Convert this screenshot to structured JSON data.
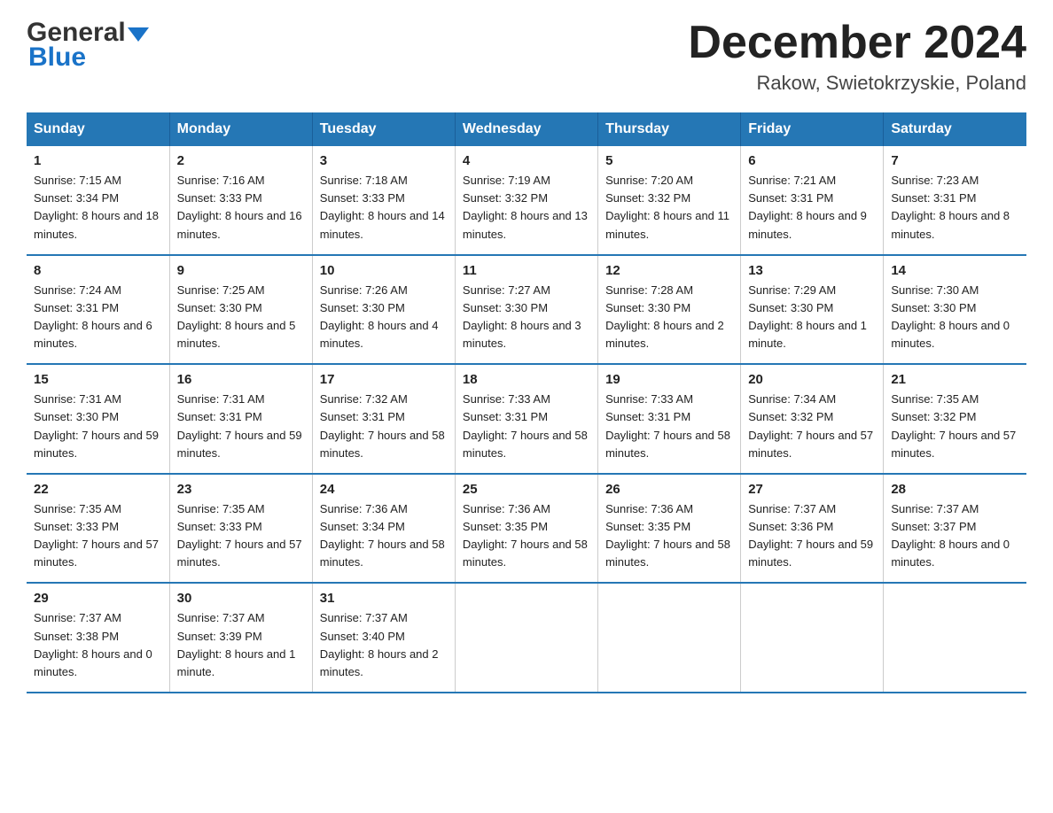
{
  "logo": {
    "line1": "General",
    "arrow": "▼",
    "line2": "Blue"
  },
  "title": {
    "month_year": "December 2024",
    "location": "Rakow, Swietokrzyskie, Poland"
  },
  "columns": [
    "Sunday",
    "Monday",
    "Tuesday",
    "Wednesday",
    "Thursday",
    "Friday",
    "Saturday"
  ],
  "weeks": [
    [
      {
        "day": "1",
        "sunrise": "7:15 AM",
        "sunset": "3:34 PM",
        "daylight": "8 hours and 18 minutes."
      },
      {
        "day": "2",
        "sunrise": "7:16 AM",
        "sunset": "3:33 PM",
        "daylight": "8 hours and 16 minutes."
      },
      {
        "day": "3",
        "sunrise": "7:18 AM",
        "sunset": "3:33 PM",
        "daylight": "8 hours and 14 minutes."
      },
      {
        "day": "4",
        "sunrise": "7:19 AM",
        "sunset": "3:32 PM",
        "daylight": "8 hours and 13 minutes."
      },
      {
        "day": "5",
        "sunrise": "7:20 AM",
        "sunset": "3:32 PM",
        "daylight": "8 hours and 11 minutes."
      },
      {
        "day": "6",
        "sunrise": "7:21 AM",
        "sunset": "3:31 PM",
        "daylight": "8 hours and 9 minutes."
      },
      {
        "day": "7",
        "sunrise": "7:23 AM",
        "sunset": "3:31 PM",
        "daylight": "8 hours and 8 minutes."
      }
    ],
    [
      {
        "day": "8",
        "sunrise": "7:24 AM",
        "sunset": "3:31 PM",
        "daylight": "8 hours and 6 minutes."
      },
      {
        "day": "9",
        "sunrise": "7:25 AM",
        "sunset": "3:30 PM",
        "daylight": "8 hours and 5 minutes."
      },
      {
        "day": "10",
        "sunrise": "7:26 AM",
        "sunset": "3:30 PM",
        "daylight": "8 hours and 4 minutes."
      },
      {
        "day": "11",
        "sunrise": "7:27 AM",
        "sunset": "3:30 PM",
        "daylight": "8 hours and 3 minutes."
      },
      {
        "day": "12",
        "sunrise": "7:28 AM",
        "sunset": "3:30 PM",
        "daylight": "8 hours and 2 minutes."
      },
      {
        "day": "13",
        "sunrise": "7:29 AM",
        "sunset": "3:30 PM",
        "daylight": "8 hours and 1 minute."
      },
      {
        "day": "14",
        "sunrise": "7:30 AM",
        "sunset": "3:30 PM",
        "daylight": "8 hours and 0 minutes."
      }
    ],
    [
      {
        "day": "15",
        "sunrise": "7:31 AM",
        "sunset": "3:30 PM",
        "daylight": "7 hours and 59 minutes."
      },
      {
        "day": "16",
        "sunrise": "7:31 AM",
        "sunset": "3:31 PM",
        "daylight": "7 hours and 59 minutes."
      },
      {
        "day": "17",
        "sunrise": "7:32 AM",
        "sunset": "3:31 PM",
        "daylight": "7 hours and 58 minutes."
      },
      {
        "day": "18",
        "sunrise": "7:33 AM",
        "sunset": "3:31 PM",
        "daylight": "7 hours and 58 minutes."
      },
      {
        "day": "19",
        "sunrise": "7:33 AM",
        "sunset": "3:31 PM",
        "daylight": "7 hours and 58 minutes."
      },
      {
        "day": "20",
        "sunrise": "7:34 AM",
        "sunset": "3:32 PM",
        "daylight": "7 hours and 57 minutes."
      },
      {
        "day": "21",
        "sunrise": "7:35 AM",
        "sunset": "3:32 PM",
        "daylight": "7 hours and 57 minutes."
      }
    ],
    [
      {
        "day": "22",
        "sunrise": "7:35 AM",
        "sunset": "3:33 PM",
        "daylight": "7 hours and 57 minutes."
      },
      {
        "day": "23",
        "sunrise": "7:35 AM",
        "sunset": "3:33 PM",
        "daylight": "7 hours and 57 minutes."
      },
      {
        "day": "24",
        "sunrise": "7:36 AM",
        "sunset": "3:34 PM",
        "daylight": "7 hours and 58 minutes."
      },
      {
        "day": "25",
        "sunrise": "7:36 AM",
        "sunset": "3:35 PM",
        "daylight": "7 hours and 58 minutes."
      },
      {
        "day": "26",
        "sunrise": "7:36 AM",
        "sunset": "3:35 PM",
        "daylight": "7 hours and 58 minutes."
      },
      {
        "day": "27",
        "sunrise": "7:37 AM",
        "sunset": "3:36 PM",
        "daylight": "7 hours and 59 minutes."
      },
      {
        "day": "28",
        "sunrise": "7:37 AM",
        "sunset": "3:37 PM",
        "daylight": "8 hours and 0 minutes."
      }
    ],
    [
      {
        "day": "29",
        "sunrise": "7:37 AM",
        "sunset": "3:38 PM",
        "daylight": "8 hours and 0 minutes."
      },
      {
        "day": "30",
        "sunrise": "7:37 AM",
        "sunset": "3:39 PM",
        "daylight": "8 hours and 1 minute."
      },
      {
        "day": "31",
        "sunrise": "7:37 AM",
        "sunset": "3:40 PM",
        "daylight": "8 hours and 2 minutes."
      },
      null,
      null,
      null,
      null
    ]
  ],
  "labels": {
    "sunrise_prefix": "Sunrise: ",
    "sunset_prefix": "Sunset: ",
    "daylight_prefix": "Daylight: "
  }
}
